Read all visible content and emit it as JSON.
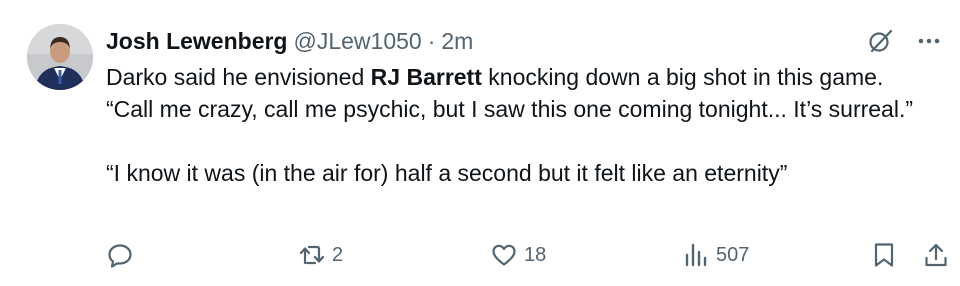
{
  "author": {
    "name": "Josh Lewenberg",
    "handle": "@JLew1050",
    "separator": "·",
    "time": "2m"
  },
  "tweet": {
    "line1_pre": "Darko said he envisioned ",
    "line1_bold": "RJ Barrett",
    "line1_post": " knocking down a big shot in this game.",
    "quote1": "“Call me crazy, call me psychic, but I saw this one coming tonight... It’s surreal.”",
    "quote2": "“I know it was (in the air for) half a second but it felt like an eternity”"
  },
  "actions": {
    "reply_count": "",
    "retweet_count": "2",
    "like_count": "18",
    "views_count": "507"
  },
  "icons": {
    "grok": "grok-icon",
    "more": "more-icon",
    "reply": "reply-icon",
    "retweet": "retweet-icon",
    "like": "heart-icon",
    "views": "views-icon",
    "bookmark": "bookmark-icon",
    "share": "share-icon"
  },
  "colors": {
    "text": "#0f1419",
    "secondary": "#536471",
    "background": "#ffffff"
  }
}
